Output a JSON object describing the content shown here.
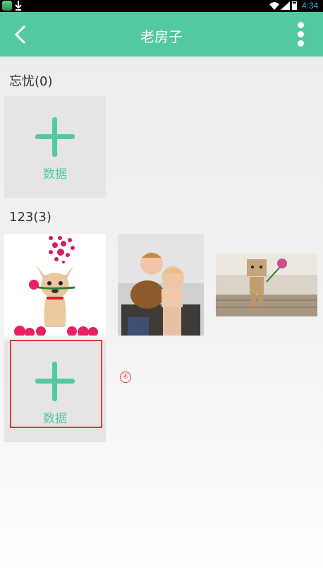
{
  "status_bar": {
    "time": "4:34",
    "icons": [
      "app-icon",
      "download-icon",
      "wifi-icon",
      "signal-icon",
      "battery-icon"
    ]
  },
  "app_bar": {
    "title": "老房子",
    "back_icon": "chevron-left-icon",
    "more_icon": "more-vertical-icon",
    "background_color": "#53c9a0"
  },
  "sections": [
    {
      "title": "忘忧(0)",
      "add_label": "数据"
    },
    {
      "title": "123(3)",
      "photos": [
        {
          "name": "chihuahua-roses-photo"
        },
        {
          "name": "children-with-basket-photo"
        },
        {
          "name": "danbo-flower-photo"
        }
      ],
      "add_label": "数据"
    }
  ],
  "annotation": {
    "marker_text": "④",
    "highlight_color": "#e0393e"
  }
}
